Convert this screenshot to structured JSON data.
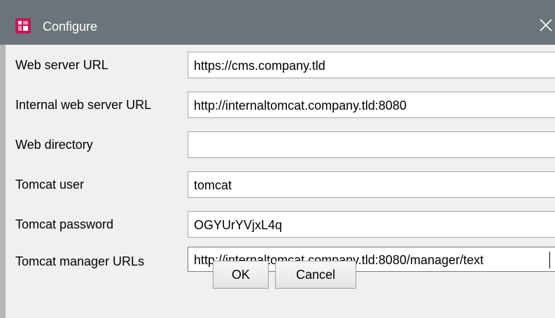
{
  "window": {
    "title": "Configure",
    "titlebar_color": "#6b7579",
    "icon": "app-logo-icon",
    "close_icon": "close-icon"
  },
  "rows": [
    {
      "label": "Web server URL",
      "value": "https://cms.company.tld"
    },
    {
      "label": "Internal web server URL",
      "value": "http://internaltomcat.company.tld:8080"
    },
    {
      "label": "Web directory",
      "value": ""
    },
    {
      "label": "Tomcat user",
      "value": "tomcat"
    },
    {
      "label": "Tomcat password",
      "value": "OGYUrYVjxL4q"
    },
    {
      "label": "Tomcat manager URLs",
      "value": "http://internaltomcat.company.tld:8080/manager/text"
    }
  ],
  "buttons": {
    "ok_label": "OK",
    "cancel_label": "Cancel"
  }
}
